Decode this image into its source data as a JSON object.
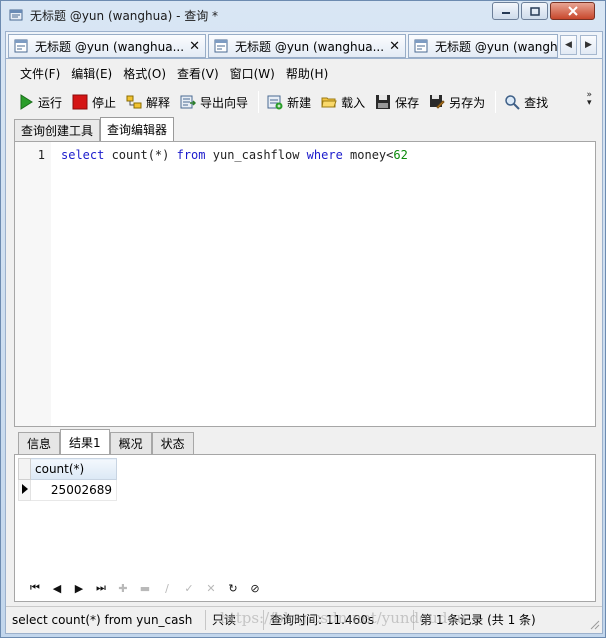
{
  "window": {
    "title": "无标题 @yun (wanghua) - 查询 *",
    "controls": {
      "minimize": "minimize",
      "maximize": "maximize",
      "close": "close"
    }
  },
  "doc_tabs": [
    {
      "label": "无标题 @yun (wanghua...",
      "active": true
    },
    {
      "label": "无标题 @yun (wanghua...",
      "active": false
    },
    {
      "label": "无标题 @yun (wanghu",
      "active": false
    }
  ],
  "menu": [
    "文件(F)",
    "编辑(E)",
    "格式(O)",
    "查看(V)",
    "窗口(W)",
    "帮助(H)"
  ],
  "toolbar": {
    "run": "运行",
    "stop": "停止",
    "explain": "解释",
    "export": "导出向导",
    "new": "新建",
    "load": "载入",
    "save": "保存",
    "save_as": "另存为",
    "find": "查找"
  },
  "editor_tabs": [
    "查询创建工具",
    "查询编辑器"
  ],
  "editor": {
    "line_number": "1",
    "tokens": {
      "select": "select",
      "count": " count(*) ",
      "from": "from",
      "table": " yun_cashflow ",
      "where": "where",
      "cond": " money<",
      "value": "62"
    }
  },
  "result_tabs": [
    "信息",
    "结果1",
    "概况",
    "状态"
  ],
  "result_grid": {
    "columns": [
      "count(*)"
    ],
    "rows": [
      [
        "25002689"
      ]
    ]
  },
  "statusbar": {
    "sql": "select count(*) from yun_cash",
    "mode": "只读",
    "time": "查询时间: 11.460s",
    "records": "第 1 条记录 (共 1 条)"
  },
  "watermark": "https://blog.csdn.net/yundoudou",
  "colors": {
    "accent": "#1b1bcc",
    "number": "#0a8a0a",
    "run_green": "#2a9d2a",
    "stop_red": "#d51515"
  }
}
